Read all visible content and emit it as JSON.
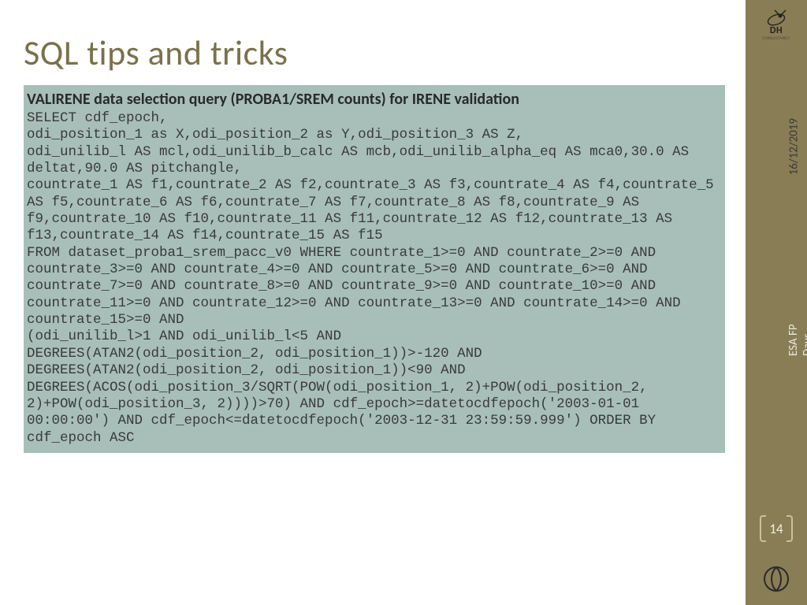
{
  "title": "SQL tips and tricks",
  "subtitle": "VALIRENE data selection query (PROBA1/SREM counts) for IRENE validation",
  "code": "SELECT cdf_epoch,\nodi_position_1 as X,odi_position_2 as Y,odi_position_3 AS Z,\nodi_unilib_l AS mcl,odi_unilib_b_calc AS mcb,odi_unilib_alpha_eq AS mca0,30.0 AS deltat,90.0 AS pitchangle,\ncountrate_1 AS f1,countrate_2 AS f2,countrate_3 AS f3,countrate_4 AS f4,countrate_5 AS f5,countrate_6 AS f6,countrate_7 AS f7,countrate_8 AS f8,countrate_9 AS f9,countrate_10 AS f10,countrate_11 AS f11,countrate_12 AS f12,countrate_13 AS f13,countrate_14 AS f14,countrate_15 AS f15\nFROM dataset_proba1_srem_pacc_v0 WHERE countrate_1>=0 AND countrate_2>=0 AND countrate_3>=0 AND countrate_4>=0 AND countrate_5>=0 AND countrate_6>=0 AND countrate_7>=0 AND countrate_8>=0 AND countrate_9>=0 AND countrate_10>=0 AND countrate_11>=0 AND countrate_12>=0 AND countrate_13>=0 AND countrate_14>=0 AND countrate_15>=0 AND\n(odi_unilib_l>1 AND odi_unilib_l<5 AND\nDEGREES(ATAN2(odi_position_2, odi_position_1))>-120 AND\nDEGREES(ATAN2(odi_position_2, odi_position_1))<90 AND\nDEGREES(ACOS(odi_position_3/SQRT(POW(odi_position_1, 2)+POW(odi_position_2, 2)+POW(odi_position_3, 2))))>70) AND cdf_epoch>=datetocdfepoch('2003-01-01 00:00:00') AND cdf_epoch<=datetocdfepoch('2003-12-31 23:59:59.999') ORDER BY cdf_epoch ASC",
  "sidebar": {
    "logo_text": "DH",
    "logo_sub": "CONSULTANCY",
    "date": "16/12/2019",
    "event": "ESA FP Days, ESTEC",
    "page": "14"
  }
}
